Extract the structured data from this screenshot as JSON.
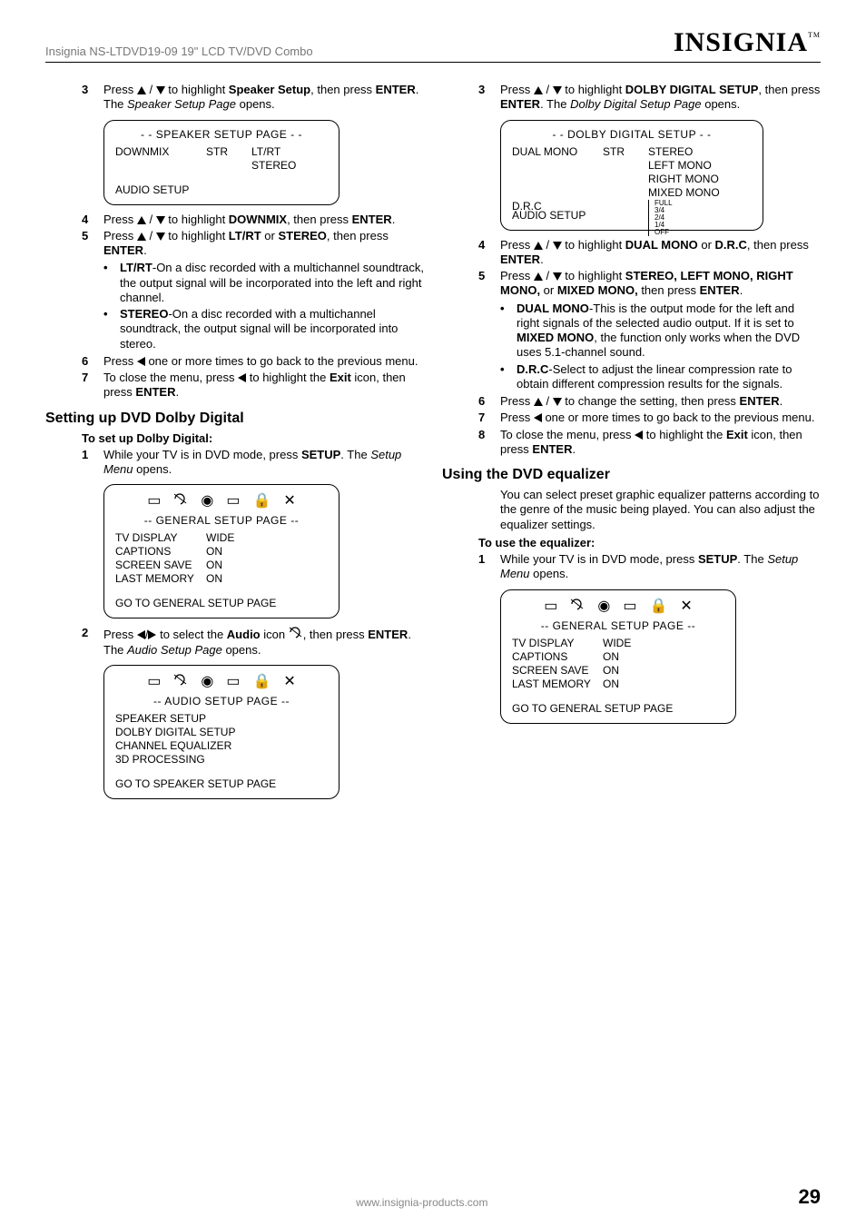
{
  "header": {
    "model": "Insignia NS-LTDVD19-09 19\" LCD TV/DVD Combo",
    "brand": "INSIGNIA",
    "tm": "TM"
  },
  "left": {
    "s3a": "Press ",
    "s3b": " to highlight ",
    "s3c": "Speaker Setup",
    "s3d": ", then press ",
    "s3e": "ENTER",
    "s3f": ". The ",
    "s3g": "Speaker Setup Page",
    "s3h": " opens.",
    "osd1": {
      "title": "- - SPEAKER SETUP PAGE - -",
      "r1c1": "DOWNMIX",
      "r1c2": "STR",
      "r1c3": "LT/RT",
      "r2c3": "STEREO",
      "footer": "AUDIO SETUP"
    },
    "s4a": "Press ",
    "s4b": " to highlight ",
    "s4c": "DOWNMIX",
    "s4d": ", then press ",
    "s4e": "ENTER",
    "s4f": ".",
    "s5a": "Press ",
    "s5b": " to highlight ",
    "s5c": "LT/RT",
    "s5d": " or ",
    "s5e": "STEREO",
    "s5f": ", then press ",
    "s5g": "ENTER",
    "s5h": ".",
    "b1a": "LT/RT",
    "b1b": "-On a disc recorded with a multichannel soundtrack, the output signal will be incorporated into the left and right channel.",
    "b2a": "STEREO",
    "b2b": "-On a disc recorded with a multichannel soundtrack, the output signal will be incorporated into stereo.",
    "s6a": "Press ",
    "s6b": " one or more times to go back to the previous menu.",
    "s7a": "To close the menu, press ",
    "s7b": " to highlight the ",
    "s7c": "Exit",
    "s7d": " icon, then press ",
    "s7e": "ENTER",
    "s7f": ".",
    "h3": "Setting up DVD Dolby Digital",
    "h4": "To set up Dolby Digital:",
    "s1a": "While your TV is in DVD mode, press ",
    "s1b": "SETUP",
    "s1c": ". The ",
    "s1d": "Setup Menu",
    "s1e": " opens.",
    "osd2": {
      "title": "--  GENERAL SETUP PAGE --",
      "r1c1": "TV DISPLAY",
      "r1c3": "WIDE",
      "r2c1": "CAPTIONS",
      "r2c3": "ON",
      "r3c1": "SCREEN SAVE",
      "r3c3": "ON",
      "r4c1": "LAST MEMORY",
      "r4c3": "ON",
      "footer": "GO TO GENERAL SETUP PAGE"
    },
    "s2a": "Press ",
    "s2b": " to select the ",
    "s2c": "Audio",
    "s2d": " icon ",
    "s2e": ", then press ",
    "s2f": "ENTER",
    "s2g": ". The ",
    "s2h": "Audio Setup Page",
    "s2i": " opens.",
    "osd3": {
      "title": "-- AUDIO SETUP PAGE --",
      "r1": "SPEAKER SETUP",
      "r2": "DOLBY DIGITAL SETUP",
      "r3": "CHANNEL EQUALIZER",
      "r4": "3D PROCESSING",
      "footer": "GO TO SPEAKER SETUP PAGE"
    }
  },
  "right": {
    "s3a": "Press ",
    "s3b": " to highlight ",
    "s3c": "DOLBY DIGITAL SETUP",
    "s3d": ", then press ",
    "s3e": "ENTER",
    "s3f": ". The ",
    "s3g": "Dolby Digital Setup Page",
    "s3h": " opens.",
    "osd1": {
      "title": "- - DOLBY DIGITAL SETUP  - -",
      "r1c1": "DUAL MONO",
      "r1c2": "STR",
      "r1c3": "STEREO",
      "r2c3": "LEFT MONO",
      "r3c3": "RIGHT MONO",
      "r4c3": "MIXED MONO",
      "r5c1": "D.R.C",
      "r6c1": "AUDIO SETUP",
      "drc": [
        "FULL",
        "3/4",
        "2/4",
        "1/4",
        "OFF"
      ]
    },
    "s4a": "Press ",
    "s4b": " to highlight ",
    "s4c": "DUAL MONO",
    "s4d": " or ",
    "s4e": "D.R.C",
    "s4f": ", then press ",
    "s4g": "ENTER",
    "s4h": ".",
    "s5a": "Press ",
    "s5b": " to highlight ",
    "s5c": "STEREO, LEFT MONO, RIGHT MONO,",
    "s5d": " or ",
    "s5e": "MIXED MONO,",
    "s5f": " then press ",
    "s5g": "ENTER",
    "s5h": ".",
    "b1a": "DUAL MONO",
    "b1b": "-This is the output mode for the left and right signals of the selected audio output. If it is set to ",
    "b1c": "MIXED MONO",
    "b1d": ", the function only works when the DVD uses 5.1-channel sound.",
    "b2a": "D.R.C",
    "b2b": "-Select to adjust the linear compression rate to obtain different compression results for the signals.",
    "s6a": "Press ",
    "s6b": " to change the setting, then press ",
    "s6c": "ENTER",
    "s6d": ".",
    "s7a": "Press ",
    "s7b": " one or more times to go back to the previous menu.",
    "s8a": "To close the menu, press ",
    "s8b": " to highlight the ",
    "s8c": "Exit",
    "s8d": " icon, then press ",
    "s8e": "ENTER",
    "s8f": ".",
    "h3": "Using the DVD equalizer",
    "p1": "You can select preset graphic equalizer patterns according to the genre of the music being played. You can also adjust the equalizer settings.",
    "h4": "To use the equalizer:",
    "s1a": "While your TV is in DVD mode, press ",
    "s1b": "SETUP",
    "s1c": ". The ",
    "s1d": "Setup Menu",
    "s1e": " opens.",
    "osd2": {
      "title": "--  GENERAL SETUP PAGE --",
      "r1c1": "TV DISPLAY",
      "r1c3": "WIDE",
      "r2c1": "CAPTIONS",
      "r2c3": "ON",
      "r3c1": "SCREEN SAVE",
      "r3c3": "ON",
      "r4c1": "LAST MEMORY",
      "r4c3": "ON",
      "footer": "GO TO GENERAL SETUP PAGE"
    }
  },
  "footer": {
    "url": "www.insignia-products.com",
    "page": "29"
  }
}
